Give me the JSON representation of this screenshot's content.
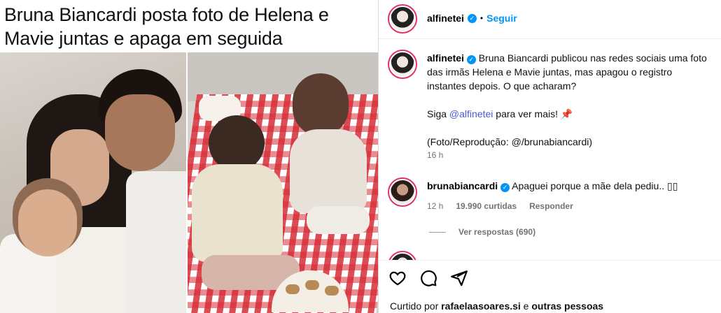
{
  "post": {
    "headline": "Bruna Biancardi posta foto de Helena e Mavie juntas e apaga em seguida"
  },
  "header": {
    "username": "alfinetei",
    "separator": "•",
    "follow_label": "Seguir"
  },
  "caption": {
    "username": "alfinetei",
    "text": "Bruna Biancardi publicou nas redes sociais uma foto das irmãs Helena e Mavie juntas, mas apagou o registro instantes depois. O que acharam?",
    "cta_prefix": "Siga ",
    "cta_mention": "@alfinetei",
    "cta_suffix": " para ver mais! ",
    "credit": "(Foto/Reprodução: @/brunabiancardi)",
    "time": "16 h"
  },
  "comment": {
    "username": "brunabiancardi",
    "text": "Apaguei porque a mãe dela pediu.. ▯▯",
    "time": "12 h",
    "likes": "19.990 curtidas",
    "reply_label": "Responder",
    "view_replies": "Ver respostas (690)"
  },
  "footer": {
    "liked_prefix": "Curtido por ",
    "liked_user": "rafaelaasoares.si",
    "liked_middle": " e ",
    "liked_others": "outras pessoas"
  },
  "icons": [
    "heart-icon",
    "comment-icon",
    "share-icon",
    "verified-icon",
    "pin-icon"
  ],
  "colors": {
    "link": "#0095f6",
    "mention": "#4a5ad0",
    "muted": "#737373",
    "ring": "#e1306c"
  }
}
